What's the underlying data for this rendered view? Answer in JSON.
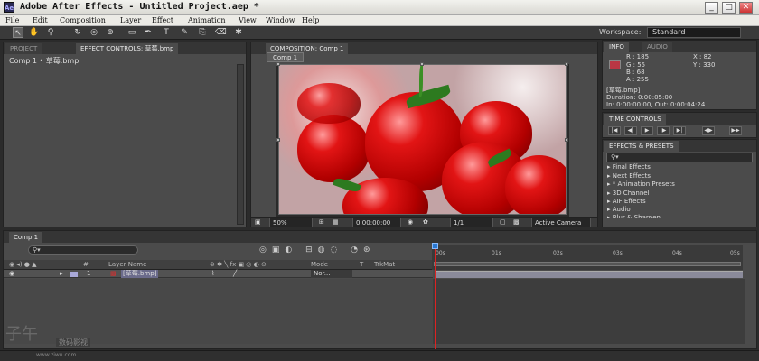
{
  "window": {
    "title": "Adobe After Effects - Untitled Project.aep *",
    "app_icon": "Ae",
    "minimize": "_",
    "maximize": "□",
    "close": "✕"
  },
  "menu": [
    "File",
    "Edit",
    "Composition",
    "Layer",
    "Effect",
    "Animation",
    "View",
    "Window",
    "Help"
  ],
  "toolbar": {
    "workspace_label": "Workspace:",
    "workspace_value": "Standard"
  },
  "left_panel": {
    "tabs": [
      "PROJECT",
      "EFFECT CONTROLS: 草莓.bmp"
    ],
    "layer_path": "Comp 1 • 草莓.bmp"
  },
  "composition": {
    "tab": "COMPOSITION: Comp 1",
    "subtab": "Comp 1",
    "zoom": "50%",
    "timecode": "0:00:00:00",
    "resolution": "1/1",
    "view": "Active Camera"
  },
  "info": {
    "tabs": [
      "INFO",
      "AUDIO"
    ],
    "r": "R : 185",
    "g": "G : 55",
    "b": "B : 68",
    "a": "A : 255",
    "x": "X : 82",
    "y": "Y : 330",
    "swatch_color": "#b93744",
    "layer": "[草莓.bmp]",
    "duration": "Duration: 0:00:05:00",
    "in_out": "In: 0:00:00:00, Out: 0:00:04:24"
  },
  "time_controls": {
    "tab": "TIME CONTROLS",
    "buttons": [
      "|◀",
      "◀|",
      "▶",
      "|▶",
      "▶|",
      "◀▶",
      "▶▶"
    ]
  },
  "effects": {
    "tab": "EFFECTS & PRESETS",
    "search_placeholder": "",
    "items": [
      "▸ Final Effects",
      "▸ Next Effects",
      "▸ * Animation Presets",
      "▸ 3D Channel",
      "▸ AIF Effects",
      "▸ Audio",
      "▸ Blur & Sharpen"
    ]
  },
  "timeline": {
    "tab": "Comp 1",
    "columns": {
      "num": "#",
      "source": "Layer Name",
      "mode": "Mode",
      "t": "T",
      "trkmat": "TrkMat"
    },
    "layer": {
      "num": "1",
      "name": "[草莓.bmp]",
      "mode": "Nor..."
    },
    "ruler": [
      "00s",
      "01s",
      "02s",
      "03s",
      "04s",
      "05s"
    ]
  },
  "watermark": {
    "main": "子午",
    "sub": "数码影视",
    "url": "www.ziwu.com"
  }
}
